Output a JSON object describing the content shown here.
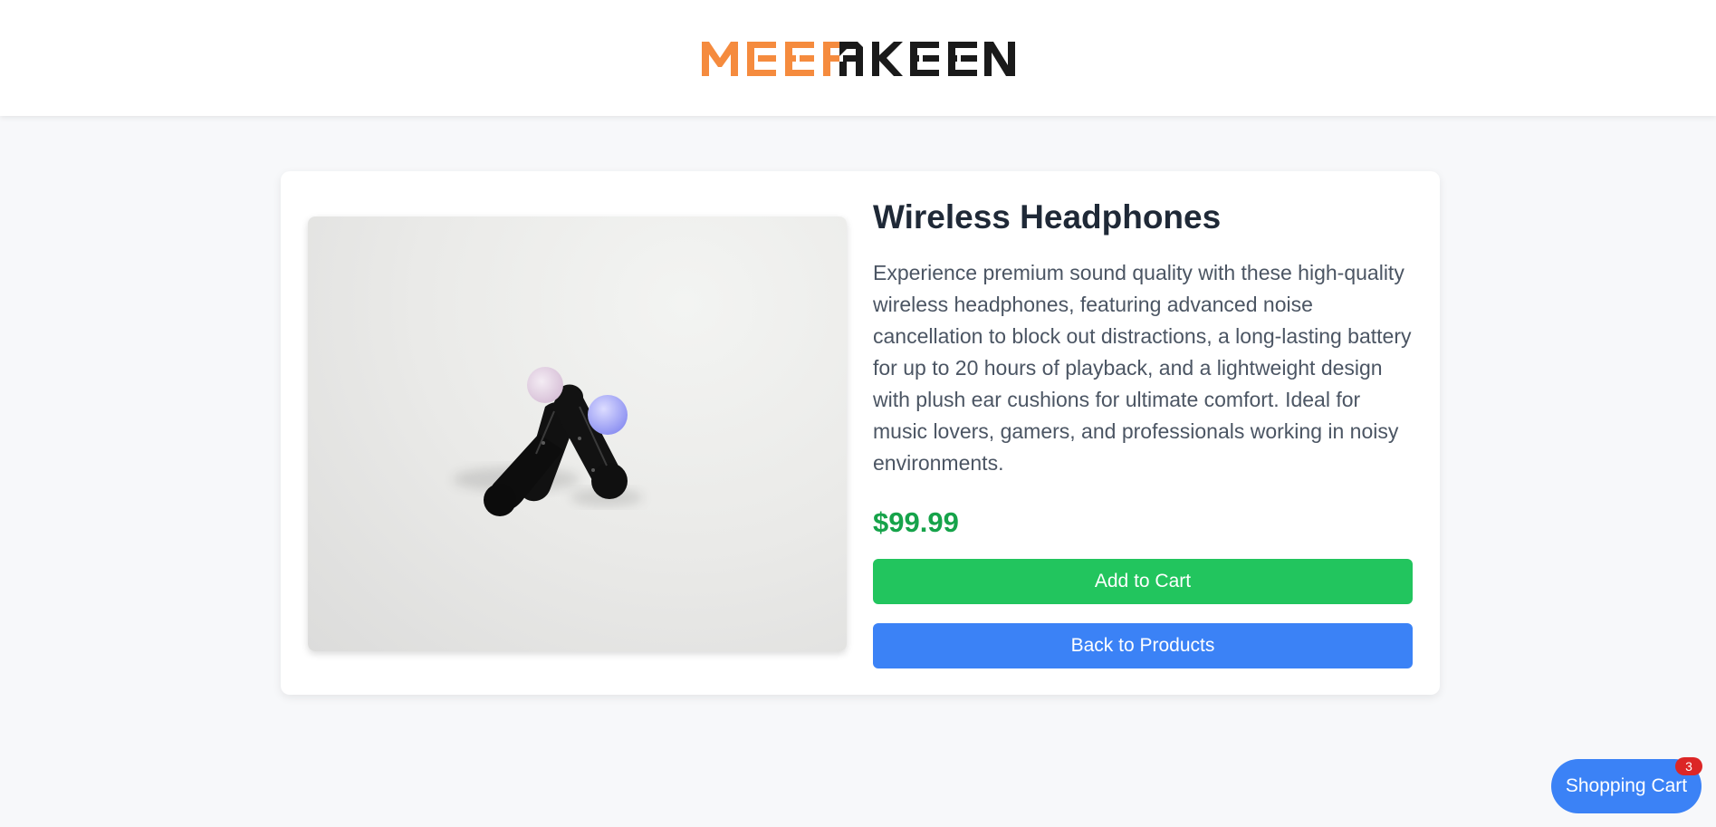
{
  "header": {
    "logo_text": "MEERAKEN",
    "logo_colors": {
      "orange": "#f58b3e",
      "black": "#1a1a1a"
    }
  },
  "product": {
    "image_description_icon": "motion-controller-image",
    "title": "Wireless Headphones",
    "description": "Experience premium sound quality with these high-quality wireless headphones, featuring advanced noise cancellation to block out distractions, a long-lasting battery for up to 20 hours of playback, and a lightweight design with plush ear cushions for ultimate comfort. Ideal for music lovers, gamers, and professionals working in noisy environments.",
    "price": "$99.99",
    "add_to_cart_label": "Add to Cart",
    "back_label": "Back to Products"
  },
  "cart": {
    "label": "Shopping Cart",
    "count": "3"
  },
  "colors": {
    "green": "#22c55e",
    "blue": "#3b82f6",
    "price_green": "#16a34a",
    "badge_red": "#dc2626"
  }
}
